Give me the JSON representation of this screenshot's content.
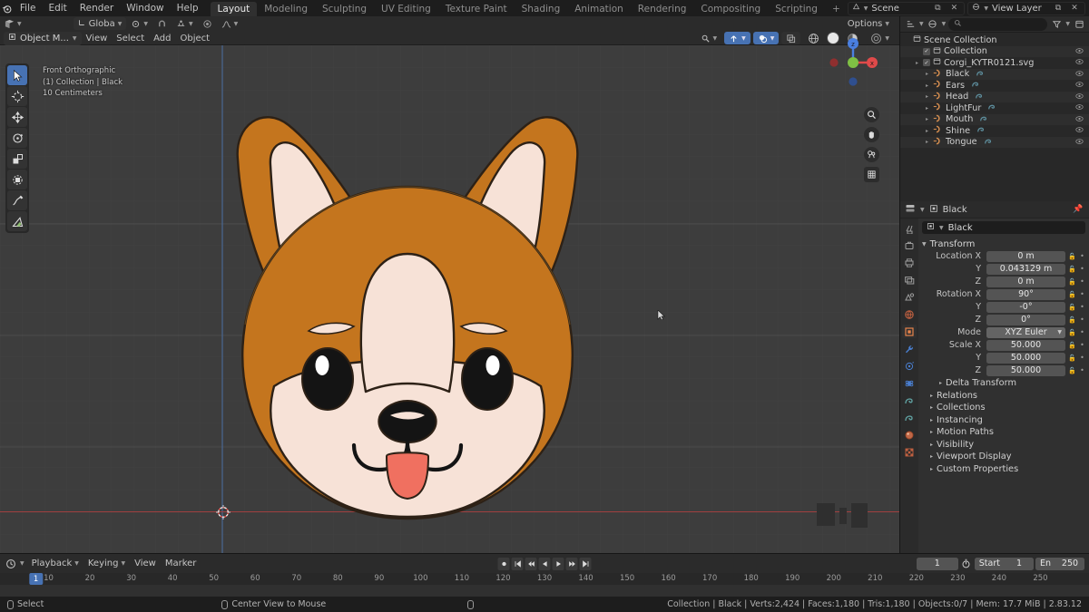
{
  "app": {
    "name": "Blender",
    "version": "2.83.12"
  },
  "topbar": {
    "logo_icon": "blender-logo-icon",
    "menus": [
      "File",
      "Edit",
      "Render",
      "Window",
      "Help"
    ],
    "workspace_tabs": [
      {
        "label": "Layout",
        "active": true
      },
      {
        "label": "Modeling",
        "active": false
      },
      {
        "label": "Sculpting",
        "active": false
      },
      {
        "label": "UV Editing",
        "active": false
      },
      {
        "label": "Texture Paint",
        "active": false
      },
      {
        "label": "Shading",
        "active": false
      },
      {
        "label": "Animation",
        "active": false
      },
      {
        "label": "Rendering",
        "active": false
      },
      {
        "label": "Compositing",
        "active": false
      },
      {
        "label": "Scripting",
        "active": false
      },
      {
        "label": "+",
        "active": false
      }
    ],
    "scene": {
      "icon": "scene-icon",
      "name": "Scene",
      "copy_icon": "copy-icon",
      "close_icon": "x-icon"
    },
    "view_layer": {
      "icon": "view-layer-icon",
      "name": "View Layer",
      "copy_icon": "copy-icon",
      "close_icon": "x-icon"
    }
  },
  "viewport": {
    "header": {
      "editor_type_icon": "editor-type-icon",
      "mode": "Object M...",
      "mode_icon": "object-mode-icon",
      "menus": [
        "View",
        "Select",
        "Add",
        "Object"
      ],
      "transform_orientation": "Globa",
      "transform_orientation_icon": "orientation-icon",
      "pivot_icon": "pivot-point-icon",
      "snap_icon": "magnet-icon",
      "snap_target_icon": "snap-target-icon",
      "proportional_icon": "proportional-edit-icon",
      "falloff_icon": "falloff-curve-icon",
      "options_label": "Options",
      "visibility_icon": "visibility-icon",
      "gizmo_icon": "gizmo-icon",
      "overlays_icon": "overlays-icon",
      "xray_icon": "xray-icon",
      "shading_wireframe_icon": "shading-wireframe-icon",
      "shading_solid_icon": "shading-solid-icon",
      "shading_material_icon": "shading-material-icon",
      "shading_rendered_icon": "shading-rendered-icon"
    },
    "toolbar": [
      {
        "name": "tweak-select-tool",
        "icon": "cursor-arrow-icon",
        "active": true
      },
      {
        "name": "cursor-tool",
        "icon": "3d-cursor-icon",
        "active": false
      },
      {
        "name": "move-tool",
        "icon": "move-arrows-icon",
        "active": false
      },
      {
        "name": "rotate-tool",
        "icon": "rotate-icon",
        "active": false
      },
      {
        "name": "scale-tool",
        "icon": "scale-icon",
        "active": false
      },
      {
        "name": "transform-tool",
        "icon": "transform-icon",
        "active": false
      },
      {
        "name": "annotate-tool",
        "icon": "pencil-icon",
        "active": false
      },
      {
        "name": "measure-tool",
        "icon": "ruler-icon",
        "active": false
      }
    ],
    "overlay_text": {
      "view_name": "Front Orthographic",
      "collection_object": "(1) Collection | Black",
      "grid_scale": "10 Centimeters"
    },
    "gizmo": {
      "x_label": "x",
      "y_label": "y",
      "z_label": "z",
      "x_color": "#e04a4a",
      "y_color": "#7fc044",
      "z_color": "#4a7fe0"
    },
    "nav_buttons": [
      {
        "name": "zoom-button",
        "icon": "magnifier-icon"
      },
      {
        "name": "pan-button",
        "icon": "hand-icon"
      },
      {
        "name": "camera-view-button",
        "icon": "camera-icon"
      },
      {
        "name": "toggle-ortho-button",
        "icon": "grid-icon"
      }
    ],
    "model": {
      "name": "Corgi head",
      "colors": {
        "fur_orange": "#c4751e",
        "fur_cream": "#f7e2d7",
        "outline": "#2d2116",
        "eye_dark": "#141414",
        "eye_shine": "#ffffff",
        "tongue": "#f07060",
        "nose": "#141414"
      }
    },
    "floor_line_color": "#a04040",
    "axis_line_color": "#4a6a9a"
  },
  "outliner": {
    "display_mode_icon": "outliner-display-icon",
    "filter_icon": "filter-icon",
    "search_icon": "search-icon",
    "search_placeholder": "",
    "new_collection_icon": "new-collection-icon",
    "rows": [
      {
        "label": "Scene Collection",
        "depth": 0,
        "icon": "collection-icon",
        "checkbox": false,
        "disclosure": false,
        "eye": false,
        "alt": false
      },
      {
        "label": "Collection",
        "depth": 1,
        "icon": "collection-icon",
        "checkbox": true,
        "disclosure": false,
        "eye": true,
        "alt": true
      },
      {
        "label": "Corgi_KYTR0121.svg",
        "depth": 1,
        "icon": "collection-icon",
        "checkbox": true,
        "disclosure": true,
        "eye": true,
        "alt": false
      },
      {
        "label": "Black",
        "depth": 2,
        "icon": "curve-icon",
        "checkbox": false,
        "disclosure": true,
        "eye": true,
        "alt": true,
        "data_icon": "curve-data-icon"
      },
      {
        "label": "Ears",
        "depth": 2,
        "icon": "curve-icon",
        "checkbox": false,
        "disclosure": true,
        "eye": true,
        "alt": false,
        "data_icon": "curve-data-icon"
      },
      {
        "label": "Head",
        "depth": 2,
        "icon": "curve-icon",
        "checkbox": false,
        "disclosure": true,
        "eye": true,
        "alt": true,
        "data_icon": "curve-data-icon"
      },
      {
        "label": "LightFur",
        "depth": 2,
        "icon": "curve-icon",
        "checkbox": false,
        "disclosure": true,
        "eye": true,
        "alt": false,
        "data_icon": "curve-data-icon"
      },
      {
        "label": "Mouth",
        "depth": 2,
        "icon": "curve-icon",
        "checkbox": false,
        "disclosure": true,
        "eye": true,
        "alt": true,
        "data_icon": "curve-data-icon"
      },
      {
        "label": "Shine",
        "depth": 2,
        "icon": "curve-icon",
        "checkbox": false,
        "disclosure": true,
        "eye": true,
        "alt": false,
        "data_icon": "curve-data-icon"
      },
      {
        "label": "Tongue",
        "depth": 2,
        "icon": "curve-icon",
        "checkbox": false,
        "disclosure": true,
        "eye": true,
        "alt": true,
        "data_icon": "curve-data-icon"
      }
    ]
  },
  "properties": {
    "editor_icon": "properties-editor-icon",
    "breadcrumb_icon": "object-icon",
    "breadcrumb": "Black",
    "pin_icon": "pin-icon",
    "object_name": "Black",
    "object_name_icon": "object-icon",
    "tabs": [
      {
        "name": "tool-tab",
        "icon": "tool-icon",
        "active": false
      },
      {
        "name": "render-tab",
        "icon": "render-icon",
        "active": false
      },
      {
        "name": "output-tab",
        "icon": "printer-icon",
        "active": false
      },
      {
        "name": "view-layer-tab",
        "icon": "images-icon",
        "active": false
      },
      {
        "name": "scene-tab",
        "icon": "scene-cone-icon",
        "active": false
      },
      {
        "name": "world-tab",
        "icon": "world-icon",
        "active": false
      },
      {
        "name": "object-tab",
        "icon": "object-square-icon",
        "active": true
      },
      {
        "name": "modifier-tab",
        "icon": "wrench-icon",
        "active": false
      },
      {
        "name": "particles-tab",
        "icon": "particles-icon",
        "active": false
      },
      {
        "name": "physics-tab",
        "icon": "physics-icon",
        "active": false
      },
      {
        "name": "constraints-tab",
        "icon": "constraints-icon",
        "active": false
      },
      {
        "name": "data-tab",
        "icon": "curve-data-icon",
        "active": false
      },
      {
        "name": "material-tab",
        "icon": "material-sphere-icon",
        "active": false
      },
      {
        "name": "texture-tab",
        "icon": "texture-checker-icon",
        "active": false
      }
    ],
    "transform": {
      "title": "Transform",
      "expanded": true,
      "fields": [
        {
          "label": "Location X",
          "value": "0 m"
        },
        {
          "label": "Y",
          "value": "0.043129 m"
        },
        {
          "label": "Z",
          "value": "0 m"
        },
        {
          "label": "Rotation X",
          "value": "90°"
        },
        {
          "label": "Y",
          "value": "-0°"
        },
        {
          "label": "Z",
          "value": "0°"
        },
        {
          "label": "Mode",
          "value": "XYZ Euler",
          "dropdown": true
        },
        {
          "label": "Scale X",
          "value": "50.000"
        },
        {
          "label": "Y",
          "value": "50.000"
        },
        {
          "label": "Z",
          "value": "50.000"
        }
      ]
    },
    "sub_panels": [
      {
        "label": "Delta Transform",
        "indent": true
      },
      {
        "label": "Relations",
        "indent": false
      },
      {
        "label": "Collections",
        "indent": false
      },
      {
        "label": "Instancing",
        "indent": false
      },
      {
        "label": "Motion Paths",
        "indent": false
      },
      {
        "label": "Visibility",
        "indent": false
      },
      {
        "label": "Viewport Display",
        "indent": false
      },
      {
        "label": "Custom Properties",
        "indent": false
      }
    ]
  },
  "timeline": {
    "editor_icon": "timeline-editor-icon",
    "menus": [
      "Playback",
      "Keying",
      "View",
      "Marker"
    ],
    "playback_buttons": [
      {
        "name": "record-button",
        "icon": "record-icon"
      },
      {
        "name": "jump-start-button",
        "icon": "jump-start-icon"
      },
      {
        "name": "prev-keyframe-button",
        "icon": "prev-keyframe-icon"
      },
      {
        "name": "play-reverse-button",
        "icon": "play-reverse-icon"
      },
      {
        "name": "play-button",
        "icon": "play-icon"
      },
      {
        "name": "next-keyframe-button",
        "icon": "next-keyframe-icon"
      },
      {
        "name": "jump-end-button",
        "icon": "jump-end-icon"
      }
    ],
    "current_frame": "1",
    "auto_key_icon": "stopwatch-icon",
    "start_label": "Start",
    "start_value": "1",
    "end_label": "En",
    "end_value": "250",
    "playhead_frame": "1",
    "ruler_ticks": [
      "10",
      "20",
      "30",
      "40",
      "50",
      "60",
      "70",
      "80",
      "90",
      "100",
      "110",
      "120",
      "130",
      "140",
      "150",
      "160",
      "170",
      "180",
      "190",
      "200",
      "210",
      "220",
      "230",
      "240",
      "250"
    ]
  },
  "statusbar": {
    "left_items": [
      {
        "icon": "mouse-left-icon",
        "label": "Select"
      },
      {
        "icon": "mouse-middle-icon",
        "label": "Center View to Mouse"
      },
      {
        "icon": "mouse-right-icon",
        "label": ""
      }
    ],
    "scene_stats": "Collection | Black | Verts:2,424 | Faces:1,180 | Tris:1,180 | Objects:0/7 | Mem: 17.7 MiB | 2.83.12"
  }
}
